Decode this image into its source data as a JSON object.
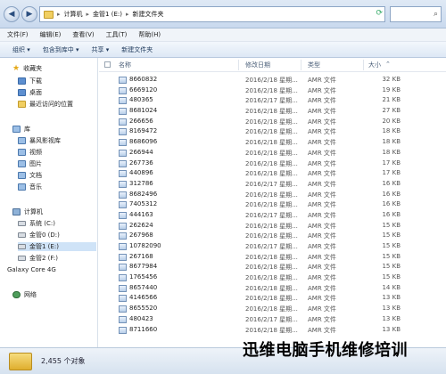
{
  "address": {
    "crumbs": [
      "计算机",
      "金管1 (E:)",
      "新建文件夹"
    ],
    "search_icon": "search-icon"
  },
  "menu": [
    "文件(F)",
    "编辑(E)",
    "查看(V)",
    "工具(T)",
    "帮助(H)"
  ],
  "toolbar": [
    "组织 ▾",
    "包含到库中 ▾",
    "共享 ▾",
    "新建文件夹"
  ],
  "nav": {
    "favorites": "收藏夹",
    "downloads": "下载",
    "desktop": "桌面",
    "recent": "最近访问的位置",
    "libraries": "库",
    "storm": "暴风影视库",
    "videos": "视频",
    "pictures": "图片",
    "documents": "文档",
    "music": "音乐",
    "computer": "计算机",
    "drive_c": "系统 (C:)",
    "drive_d": "金管0 (D:)",
    "drive_e": "金管1 (E:)",
    "drive_f": "金管2 (F:)",
    "galaxy": "Galaxy Core 4G",
    "network": "网络"
  },
  "columns": {
    "name": "名称",
    "date": "修改日期",
    "type": "类型",
    "size": "大小"
  },
  "files": [
    {
      "name": "8660832",
      "date": "2016/2/18 星期...",
      "type": "AMR 文件",
      "size": "32 KB"
    },
    {
      "name": "6669120",
      "date": "2016/2/18 星期...",
      "type": "AMR 文件",
      "size": "19 KB"
    },
    {
      "name": "480365",
      "date": "2016/2/17 星期...",
      "type": "AMR 文件",
      "size": "21 KB"
    },
    {
      "name": "8681024",
      "date": "2016/2/18 星期...",
      "type": "AMR 文件",
      "size": "27 KB"
    },
    {
      "name": "266656",
      "date": "2016/2/18 星期...",
      "type": "AMR 文件",
      "size": "20 KB"
    },
    {
      "name": "8169472",
      "date": "2016/2/18 星期...",
      "type": "AMR 文件",
      "size": "18 KB"
    },
    {
      "name": "8686096",
      "date": "2016/2/18 星期...",
      "type": "AMR 文件",
      "size": "18 KB"
    },
    {
      "name": "266944",
      "date": "2016/2/18 星期...",
      "type": "AMR 文件",
      "size": "18 KB"
    },
    {
      "name": "267736",
      "date": "2016/2/18 星期...",
      "type": "AMR 文件",
      "size": "17 KB"
    },
    {
      "name": "440896",
      "date": "2016/2/18 星期...",
      "type": "AMR 文件",
      "size": "17 KB"
    },
    {
      "name": "312786",
      "date": "2016/2/17 星期...",
      "type": "AMR 文件",
      "size": "16 KB"
    },
    {
      "name": "8682496",
      "date": "2016/2/18 星期...",
      "type": "AMR 文件",
      "size": "16 KB"
    },
    {
      "name": "7405312",
      "date": "2016/2/18 星期...",
      "type": "AMR 文件",
      "size": "16 KB"
    },
    {
      "name": "444163",
      "date": "2016/2/17 星期...",
      "type": "AMR 文件",
      "size": "16 KB"
    },
    {
      "name": "262624",
      "date": "2016/2/18 星期...",
      "type": "AMR 文件",
      "size": "15 KB"
    },
    {
      "name": "267968",
      "date": "2016/2/18 星期...",
      "type": "AMR 文件",
      "size": "15 KB"
    },
    {
      "name": "10782090",
      "date": "2016/2/17 星期...",
      "type": "AMR 文件",
      "size": "15 KB"
    },
    {
      "name": "267168",
      "date": "2016/2/18 星期...",
      "type": "AMR 文件",
      "size": "15 KB"
    },
    {
      "name": "8677984",
      "date": "2016/2/18 星期...",
      "type": "AMR 文件",
      "size": "15 KB"
    },
    {
      "name": "1765456",
      "date": "2016/2/18 星期...",
      "type": "AMR 文件",
      "size": "15 KB"
    },
    {
      "name": "8657440",
      "date": "2016/2/18 星期...",
      "type": "AMR 文件",
      "size": "14 KB"
    },
    {
      "name": "4146566",
      "date": "2016/2/18 星期...",
      "type": "AMR 文件",
      "size": "13 KB"
    },
    {
      "name": "8655520",
      "date": "2016/2/18 星期...",
      "type": "AMR 文件",
      "size": "13 KB"
    },
    {
      "name": "480423",
      "date": "2016/2/17 星期...",
      "type": "AMR 文件",
      "size": "13 KB"
    },
    {
      "name": "8711660",
      "date": "2016/2/18 星期...",
      "type": "AMR 文件",
      "size": "13 KB"
    }
  ],
  "status": {
    "count": "2,455 个对象"
  },
  "watermark": "迅维电脑手机维修培训"
}
